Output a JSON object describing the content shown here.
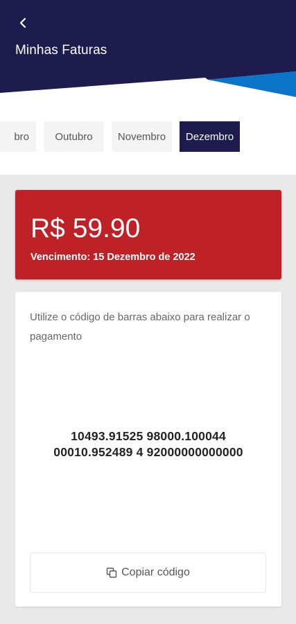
{
  "header": {
    "title": "Minhas Faturas",
    "back_icon": "chevron-left-icon",
    "colors": {
      "primary": "#1e1b4f",
      "accent": "#0a75c9"
    }
  },
  "months": {
    "items": [
      {
        "label": "bro",
        "active": false
      },
      {
        "label": "Outubro",
        "active": false
      },
      {
        "label": "Novembro",
        "active": false
      },
      {
        "label": "Dezembro",
        "active": true
      }
    ]
  },
  "invoice": {
    "amount": "R$ 59.90",
    "due_date": "Vencimento: 15 Dezembro de 2022",
    "color": "#be2126"
  },
  "barcode": {
    "instruction": "Utilize o código de barras abaixo para realizar o pagamento",
    "line1": "10493.91525 98000.100044",
    "line2": "00010.952489 4 92000000000000",
    "copy_label": "Copiar código",
    "copy_icon": "copy-icon"
  }
}
